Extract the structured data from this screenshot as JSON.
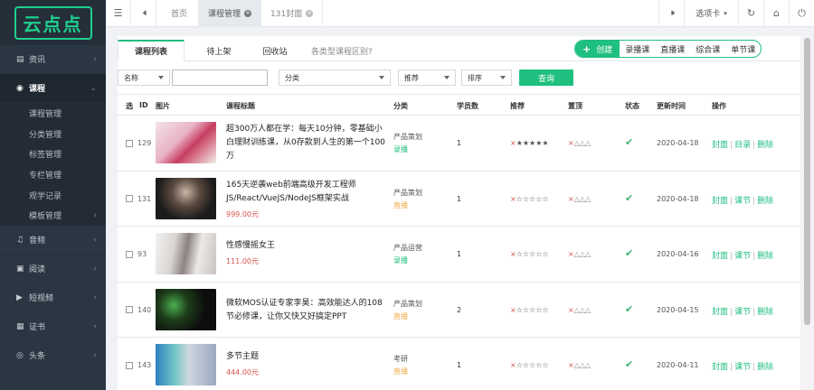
{
  "logo": {
    "text": "云点点"
  },
  "sidebar": {
    "items": [
      {
        "icon": "▤",
        "label": "资讯",
        "arrow": "‹"
      },
      {
        "icon": "◉",
        "label": "课程",
        "arrow": "⌄"
      },
      {
        "icon": "♫",
        "label": "音频",
        "arrow": "‹"
      },
      {
        "icon": "▣",
        "label": "阅读",
        "arrow": "‹"
      },
      {
        "icon": "▶",
        "label": "短视频",
        "arrow": "‹"
      },
      {
        "icon": "▦",
        "label": "证书",
        "arrow": "‹"
      },
      {
        "icon": "◎",
        "label": "头条",
        "arrow": "‹"
      }
    ],
    "sub_items": [
      {
        "label": "课程管理",
        "arrow": ""
      },
      {
        "label": "分类管理",
        "arrow": ""
      },
      {
        "label": "标签管理",
        "arrow": ""
      },
      {
        "label": "专栏管理",
        "arrow": ""
      },
      {
        "label": "观学记录",
        "arrow": ""
      },
      {
        "label": "模板管理",
        "arrow": "‹"
      }
    ]
  },
  "topbar": {
    "menu_icon": "☰",
    "back_icon": "⏴⏴",
    "tabs": [
      {
        "label": "首页"
      },
      {
        "label": "课程管理"
      },
      {
        "label": "131封面"
      }
    ],
    "forward_icon": "⏵⏵",
    "tab_card": "选项卡",
    "refresh_icon": "↻",
    "home_icon": "⌂",
    "power_icon": "⏻"
  },
  "panel": {
    "tabs": [
      {
        "label": "课程列表"
      },
      {
        "label": "待上架"
      },
      {
        "label": "回收站"
      }
    ],
    "hint": "各类型课程区别?",
    "create": "创建",
    "types": [
      "录播课",
      "直播课",
      "综合课",
      "单节课"
    ]
  },
  "filters": {
    "name_select": "名称",
    "category_select": "分类",
    "recommend_select": "推荐",
    "sort_select": "排序",
    "query": "查询"
  },
  "table": {
    "headers": {
      "select": "选",
      "id": "ID",
      "image": "图片",
      "title": "课程标题",
      "category": "分类",
      "students": "学员数",
      "recommend": "推荐",
      "top": "置顶",
      "status": "状态",
      "updated": "更新时间",
      "actions": "操作"
    },
    "rows": [
      {
        "id": "129",
        "title": "超300万人都在学：每天10分钟，零基础小白理财训练课，从0存款到人生的第一个100万",
        "price": "",
        "category": "产品策划",
        "kind": "录播",
        "kind_color": "green",
        "students": "1",
        "stars_x": "×",
        "stars": "★★★★★",
        "top_x": "×",
        "top": "△△△",
        "status": "✔",
        "date": "2020-04-18",
        "ops": [
          "封面",
          "目录",
          "删除"
        ]
      },
      {
        "id": "131",
        "title": "165天逆袭web前端高级开发工程师JS/React/VueJS/NodeJS框架实战",
        "price": "999.00元",
        "category": "产品策划",
        "kind": "直播",
        "kind_color": "orange",
        "students": "1",
        "stars_x": "×",
        "stars": "☆☆☆☆☆",
        "top_x": "×",
        "top": "△△△",
        "status": "✔",
        "date": "2020-04-18",
        "ops": [
          "封面",
          "课节",
          "删除"
        ]
      },
      {
        "id": "93",
        "title": "性感慢摇女王",
        "price": "111.00元",
        "category": "产品运营",
        "kind": "录播",
        "kind_color": "green",
        "students": "1",
        "stars_x": "×",
        "stars": "☆☆☆☆☆",
        "top_x": "×",
        "top": "△△△",
        "status": "✔",
        "date": "2020-04-16",
        "ops": [
          "封面",
          "课节",
          "删除"
        ]
      },
      {
        "id": "140",
        "title": "微软MOS认证专家李昊：高效能达人的108节必修课，让你又快又好搞定PPT",
        "price": "",
        "category": "产品策划",
        "kind": "直播",
        "kind_color": "orange",
        "students": "2",
        "stars_x": "×",
        "stars": "☆☆☆☆☆",
        "top_x": "×",
        "top": "△△△",
        "status": "✔",
        "date": "2020-04-15",
        "ops": [
          "封面",
          "课节",
          "删除"
        ]
      },
      {
        "id": "143",
        "title": "多节主题",
        "price": "444.00元",
        "category": "考研",
        "kind": "直播",
        "kind_color": "orange",
        "students": "1",
        "stars_x": "×",
        "stars": "☆☆☆☆☆",
        "top_x": "×",
        "top": "△△△",
        "status": "✔",
        "date": "2020-04-11",
        "ops": [
          "封面",
          "课节",
          "删除"
        ]
      }
    ]
  },
  "colors": {
    "accent": "#1fbf7f",
    "sidebar": "#2b3643",
    "price": "#d9534f",
    "orange": "#f0ad4e"
  }
}
